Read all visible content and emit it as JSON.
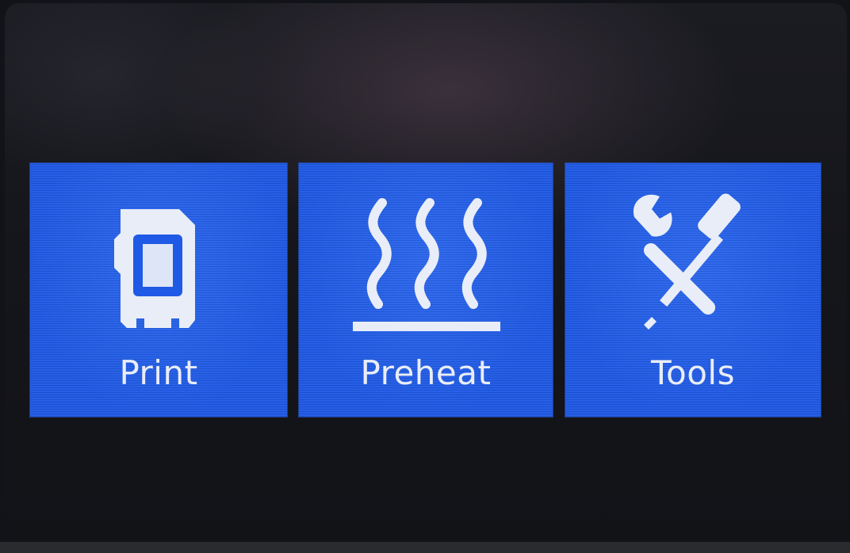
{
  "menu": {
    "items": [
      {
        "label": "Print",
        "icon": "sd-card-icon"
      },
      {
        "label": "Preheat",
        "icon": "heat-icon"
      },
      {
        "label": "Tools",
        "icon": "tools-icon"
      }
    ]
  },
  "colors": {
    "tile": "#1f5ae6",
    "icon": "#e9edf7",
    "background": "#15161b"
  }
}
